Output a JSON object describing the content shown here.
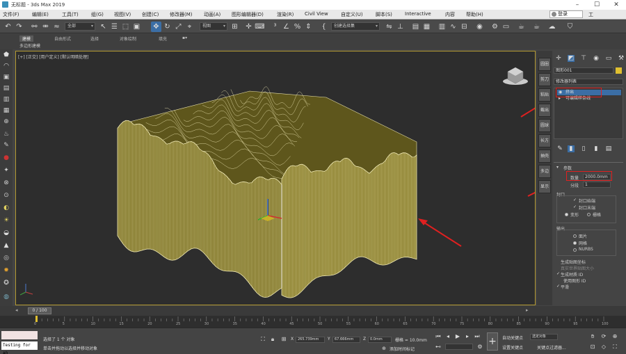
{
  "window": {
    "title": "无标题 - 3ds Max 2019",
    "min": "–",
    "max": "☐",
    "close": "✕"
  },
  "menu": {
    "items": [
      "文件(F)",
      "编辑(E)",
      "工具(T)",
      "组(G)",
      "视图(V)",
      "创建(C)",
      "修改器(M)",
      "动画(A)",
      "图形编辑器(D)",
      "渲染(R)",
      "Civil View",
      "自定义(U)",
      "脚本(S)",
      "Interactive",
      "内容",
      "帮助(H)"
    ],
    "user": "登录",
    "workspace": "工"
  },
  "toolbar": {
    "selection_filter": "全部",
    "ref_coord": "视图",
    "named_selection": "创建选择集"
  },
  "ribbon": {
    "tabs": [
      "建模",
      "自由形式",
      "选择",
      "对象绘制",
      "填充"
    ],
    "active_tab": "建模",
    "subtitle": "多边形建模"
  },
  "viewport": {
    "label": "[+] [正交] [用户定义] [默认明暗处理]"
  },
  "command_tabs": [
    "圆圈",
    "剪刀",
    "粘贴",
    "截出",
    "圆球",
    "长方",
    "抽壳",
    "多边",
    "显示"
  ],
  "command_panel": {
    "object_name": "图形001",
    "modifier_list": "修改器列表",
    "stack": [
      "挤出",
      "可编辑样条线"
    ],
    "rollout_title": "参数",
    "amount_label": "数量",
    "amount_value": "2000.0mm",
    "segments_label": "分段",
    "segments_value": "1",
    "cap_group": "封口",
    "cap_start": "封口始端",
    "cap_end": "封口末端",
    "morph": "变形",
    "grid": "栅格",
    "output_group": "输出",
    "output_patch": "面片",
    "output_mesh": "网格",
    "output_nurbs": "NURBS",
    "gen_mapping": "生成贴图坐标",
    "real_world": "真实世界贴图大小",
    "gen_mat_ids": "生成材质 ID",
    "use_shape_ids": "使用图形 ID",
    "smooth": "平滑"
  },
  "timeline": {
    "frame_display": "0 / 100",
    "ticks": [
      "0",
      "5",
      "10",
      "15",
      "20",
      "25",
      "30",
      "35",
      "40",
      "45",
      "50",
      "55",
      "60",
      "65",
      "70",
      "75",
      "80",
      "85",
      "90",
      "95",
      "100"
    ]
  },
  "status": {
    "maxscript_text": "Testing for AD",
    "selected": "选择了 1 个 对象",
    "prompt": "单击并拖动以选择并移动对象",
    "x_value": "265.739mm",
    "y_value": "67.666mm",
    "z_value": "0.0mm",
    "grid_label": "栅格 = 10.0mm",
    "add_time_tag": "添加时间标记",
    "auto_key": "自动关键点",
    "set_key": "设置关键点",
    "selected_obj": "选定对象",
    "key_filters": "关键点过滤器..."
  },
  "colors": {
    "terrain_fill": "#7b7021",
    "terrain_line": "#ece5b0",
    "viewport_border": "#b49a32",
    "annotation_red": "#e02020",
    "active_blue": "#3b6ea5"
  }
}
